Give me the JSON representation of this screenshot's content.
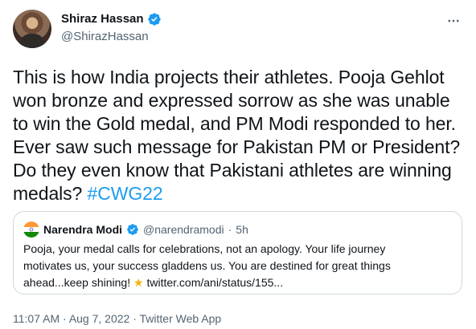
{
  "author": {
    "display_name": "Shiraz Hassan",
    "handle": "@ShirazHassan"
  },
  "tweet": {
    "text_lines": [
      "This is how India projects their athletes. Pooja Gehlot",
      "won bronze and expressed sorrow as she was unable",
      "to win the Gold medal, and PM Modi responded to her.",
      "Ever saw such message for Pakistan PM or President?",
      "Do they even know that Pakistani athletes are winning",
      "medals?"
    ],
    "hashtag": "#CWG22"
  },
  "quoted_tweet": {
    "display_name": "Narendra Modi",
    "handle": "@narendramodi",
    "separator": "·",
    "time": "5h",
    "text_lines": [
      "Pooja, your medal calls for celebrations, not an apology. Your life journey",
      "motivates us, your success gladdens us. You are destined for great things",
      "ahead...keep shining!"
    ],
    "link": "twitter.com/ani/status/155..."
  },
  "footer": {
    "time": "11:07 AM",
    "date": "Aug 7, 2022",
    "source": "Twitter Web App",
    "separator": "·"
  },
  "colors": {
    "accent": "#1d9bf0",
    "text": "#0f1419",
    "secondary": "#536471",
    "border": "#cfd9de"
  },
  "icons": [
    "verified-badge-icon",
    "more-options-icon",
    "india-flag-icon",
    "star-emoji-icon"
  ]
}
